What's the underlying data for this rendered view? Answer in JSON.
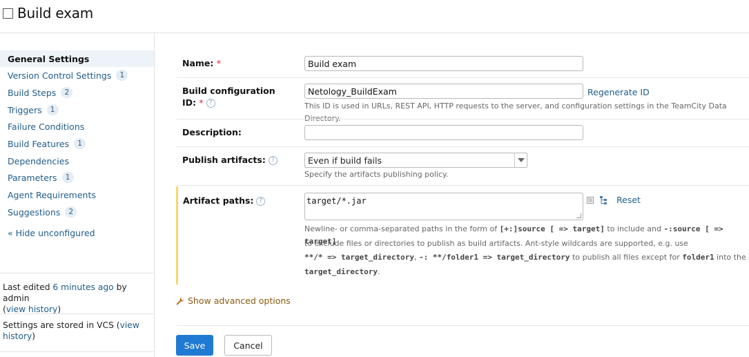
{
  "header": {
    "title": "Build exam"
  },
  "sidebar": {
    "items": [
      {
        "label": "General Settings",
        "badge": ""
      },
      {
        "label": "Version Control Settings",
        "badge": "1"
      },
      {
        "label": "Build Steps",
        "badge": "2"
      },
      {
        "label": "Triggers",
        "badge": "1"
      },
      {
        "label": "Failure Conditions",
        "badge": ""
      },
      {
        "label": "Build Features",
        "badge": "1"
      },
      {
        "label": "Dependencies",
        "badge": ""
      },
      {
        "label": "Parameters",
        "badge": "1"
      },
      {
        "label": "Agent Requirements",
        "badge": ""
      },
      {
        "label": "Suggestions",
        "badge": "2"
      }
    ],
    "hide_unconfigured": "« Hide unconfigured",
    "last_edited_prefix": "Last edited ",
    "last_edited_time": "6 minutes ago",
    "last_edited_by": " by admin",
    "view_history_open": "(",
    "view_history_label": "view history",
    "view_history_close": ")",
    "stored_prefix": "Settings are stored in VCS (",
    "stored_link_a": "view",
    "stored_link_b": "history",
    "stored_suffix": ")"
  },
  "form": {
    "name": {
      "label": "Name:",
      "required": "*",
      "value": "Build exam"
    },
    "build_config_id": {
      "label_line1": "Build configuration",
      "label_line2": "ID:",
      "required": "*",
      "value": "Netology_BuildExam",
      "regenerate": "Regenerate ID",
      "hint": "This ID is used in URLs, REST API, HTTP requests to the server, and configuration settings in the TeamCity Data Directory."
    },
    "description": {
      "label": "Description:",
      "value": ""
    },
    "publish_artifacts": {
      "label": "Publish artifacts:",
      "selected": "Even if build fails",
      "hint": "Specify the artifacts publishing policy."
    },
    "artifact_paths": {
      "label": "Artifact paths:",
      "value": "target/*.jar",
      "reset": "Reset",
      "hint_l1_a": "Newline- or comma-separated paths in the form of ",
      "hint_l1_code1": "[+:]source [ => target]",
      "hint_l1_b": " to include and ",
      "hint_l1_code2": "-:source [ => target]",
      "hint_l2": "to exclude files or directories to publish as build artifacts. Ant-style wildcards are supported, e.g. use",
      "hint_l3_code1": "**/* => target_directory",
      "hint_l3_b": ", ",
      "hint_l3_code2": "-: **/folder1 => target_directory",
      "hint_l3_c": " to publish all files except for ",
      "hint_l3_code3": "folder1",
      "hint_l3_d": " into the",
      "hint_l4_code": "target_directory",
      "hint_l4_end": "."
    },
    "advanced_options": "Show advanced options",
    "save": "Save",
    "cancel": "Cancel"
  },
  "colors": {
    "accent": "#1f7ad3",
    "link": "#1f5c8c",
    "highlight_bar": "#f6d76f"
  }
}
